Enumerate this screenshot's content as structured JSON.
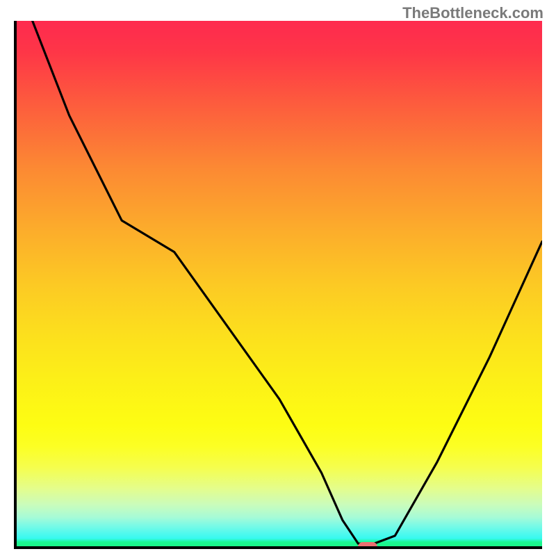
{
  "watermark": "TheBottleneck.com",
  "chart_data": {
    "type": "line",
    "title": "",
    "xlabel": "",
    "ylabel": "",
    "xlim": [
      0,
      100
    ],
    "ylim": [
      0,
      100
    ],
    "grid": false,
    "background": "red-yellow-green vertical gradient",
    "series": [
      {
        "name": "bottleneck-curve",
        "color": "#000000",
        "x": [
          3,
          10,
          20,
          30,
          40,
          50,
          58,
          62,
          65,
          68,
          72,
          80,
          90,
          100
        ],
        "y": [
          100,
          82,
          62,
          56,
          42,
          28,
          14,
          5,
          0.5,
          0.5,
          2,
          16,
          36,
          58
        ]
      }
    ],
    "marker": {
      "x": 66.5,
      "y": 0.4,
      "color": "#ed6f71"
    },
    "gradient_stops": [
      {
        "pct": 0,
        "color": "#fe2a4f"
      },
      {
        "pct": 50,
        "color": "#fcc924"
      },
      {
        "pct": 77,
        "color": "#fdfd13"
      },
      {
        "pct": 100,
        "color": "#19f789"
      }
    ]
  }
}
